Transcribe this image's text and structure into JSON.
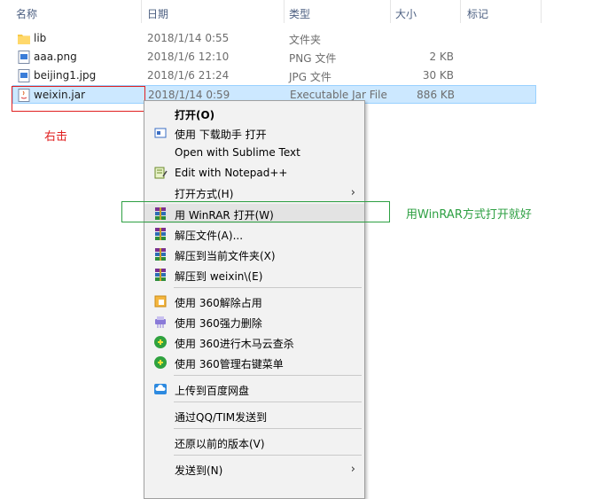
{
  "columns": {
    "name": "名称",
    "date": "日期",
    "type": "类型",
    "size": "大小",
    "tags": "标记"
  },
  "files": [
    {
      "name": "lib",
      "date": "2018/1/14 0:55",
      "type": "文件夹",
      "size": "",
      "icon": "folder-icon"
    },
    {
      "name": "aaa.png",
      "date": "2018/1/6 12:10",
      "type": "PNG 文件",
      "size": "2 KB",
      "icon": "image-file-icon"
    },
    {
      "name": "beijing1.jpg",
      "date": "2018/1/6 21:24",
      "type": "JPG 文件",
      "size": "30 KB",
      "icon": "image-file-icon"
    },
    {
      "name": "weixin.jar",
      "date": "2018/1/14 0:59",
      "type": "Executable Jar File",
      "size": "886 KB",
      "icon": "java-jar-icon"
    }
  ],
  "annotations": {
    "right_click": "右击",
    "winrar_hint": "用WinRAR方式打开就好"
  },
  "menu": {
    "open": "打开(O)",
    "xunlei_open": "使用 下载助手 打开",
    "sublime": "Open with Sublime Text",
    "notepad": "Edit with Notepad++",
    "open_with": "打开方式(H)",
    "winrar_open": "用 WinRAR 打开(W)",
    "extract_files": "解压文件(A)...",
    "extract_here": "解压到当前文件夹(X)",
    "extract_to": "解压到 weixin\\(E)",
    "unlock_360": "使用 360解除占用",
    "force_delete_360": "使用 360强力删除",
    "scan_360": "使用 360进行木马云查杀",
    "menu_mgr_360": "使用 360管理右键菜单",
    "baidu_upload": "上传到百度网盘",
    "send_qq": "通过QQ/TIM发送到",
    "restore": "还原以前的版本(V)",
    "send_to": "发送到(N)"
  },
  "colors": {
    "selection": "#cce8ff",
    "red_annotation": "#e02020",
    "green_annotation": "#2ea043"
  }
}
